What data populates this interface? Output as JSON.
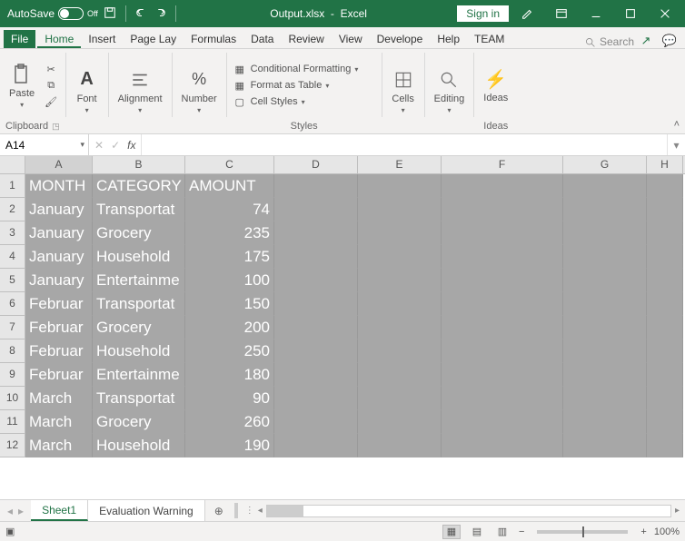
{
  "titlebar": {
    "autosave_label": "AutoSave",
    "autosave_state": "Off",
    "filename": "Output.xlsx",
    "app": "Excel",
    "signin": "Sign in"
  },
  "tabs": {
    "file": "File",
    "home": "Home",
    "insert": "Insert",
    "page": "Page Lay",
    "formulas": "Formulas",
    "data": "Data",
    "review": "Review",
    "view": "View",
    "developer": "Develope",
    "help": "Help",
    "team": "TEAM",
    "search": "Search"
  },
  "ribbon": {
    "clipboard": {
      "paste": "Paste",
      "group": "Clipboard"
    },
    "font": {
      "label": "Font"
    },
    "align": {
      "label": "Alignment"
    },
    "number": {
      "label": "Number"
    },
    "styles": {
      "cond": "Conditional Formatting",
      "table": "Format as Table",
      "cell": "Cell Styles",
      "group": "Styles"
    },
    "cells": {
      "label": "Cells"
    },
    "editing": {
      "label": "Editing"
    },
    "ideas": {
      "label": "Ideas",
      "group": "Ideas"
    }
  },
  "namebox": "A14",
  "columns": [
    "A",
    "B",
    "C",
    "D",
    "E",
    "F",
    "G",
    "H"
  ],
  "rows": [
    {
      "n": 1,
      "a": "MONTH",
      "b": "CATEGORY",
      "c": "AMOUNT"
    },
    {
      "n": 2,
      "a": "January",
      "b": "Transportat",
      "c": "74"
    },
    {
      "n": 3,
      "a": "January",
      "b": "Grocery",
      "c": "235"
    },
    {
      "n": 4,
      "a": "January",
      "b": "Household",
      "c": "175"
    },
    {
      "n": 5,
      "a": "January",
      "b": "Entertainme",
      "c": "100"
    },
    {
      "n": 6,
      "a": "Februar",
      "b": "Transportat",
      "c": "150"
    },
    {
      "n": 7,
      "a": "Februar",
      "b": "Grocery",
      "c": "200"
    },
    {
      "n": 8,
      "a": "Februar",
      "b": "Household",
      "c": "250"
    },
    {
      "n": 9,
      "a": "Februar",
      "b": "Entertainme",
      "c": "180"
    },
    {
      "n": 10,
      "a": "March",
      "b": "Transportat",
      "c": "90"
    },
    {
      "n": 11,
      "a": "March",
      "b": "Grocery",
      "c": "260"
    },
    {
      "n": 12,
      "a": "March",
      "b": "Household",
      "c": "190"
    }
  ],
  "sheets": {
    "active": "Sheet1",
    "warn": "Evaluation Warning"
  },
  "status": {
    "zoom": "100%"
  }
}
